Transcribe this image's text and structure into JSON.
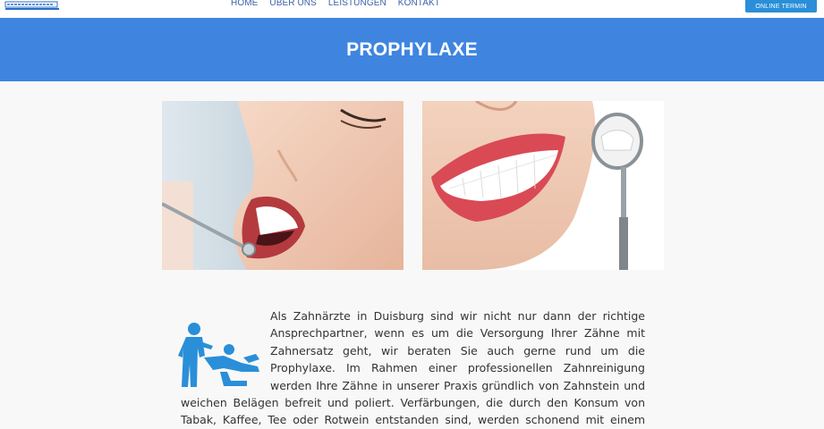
{
  "nav": {
    "items": [
      "HOME",
      "ÜBER UNS",
      "LEISTUNGEN",
      "KONTAKT"
    ],
    "cta_label": "ONLINE TERMIN"
  },
  "hero": {
    "title": "PROPHYLAXE"
  },
  "content": {
    "paragraph": "Als Zahnärzte in Duisburg sind wir nicht nur dann der richtige Ansprechpartner, wenn es um die Versorgung Ihrer Zähne mit Zahnersatz geht, wir beraten Sie auch gerne rund um die Prophylaxe. Im Rahmen einer professionellen Zahnreinigung werden Ihre Zähne in unserer Praxis gründlich von Zahnstein und weichen Belägen befreit und poliert. Verfärbungen, die durch den Konsum von Tabak, Kaffee, Tee oder Rotwein entstanden sind, werden schonend mit einem speziellen Pulverstrahlgerät( Air-Flow®)"
  },
  "colors": {
    "hero_bg": "#3f85e0",
    "cta_bg": "#2a8fd8",
    "icon": "#2a8fd8",
    "nav_text": "#3a5fa8"
  },
  "icons": {
    "logo": "dental-practice-logo",
    "illustration": "dentist-treating-patient-icon"
  }
}
